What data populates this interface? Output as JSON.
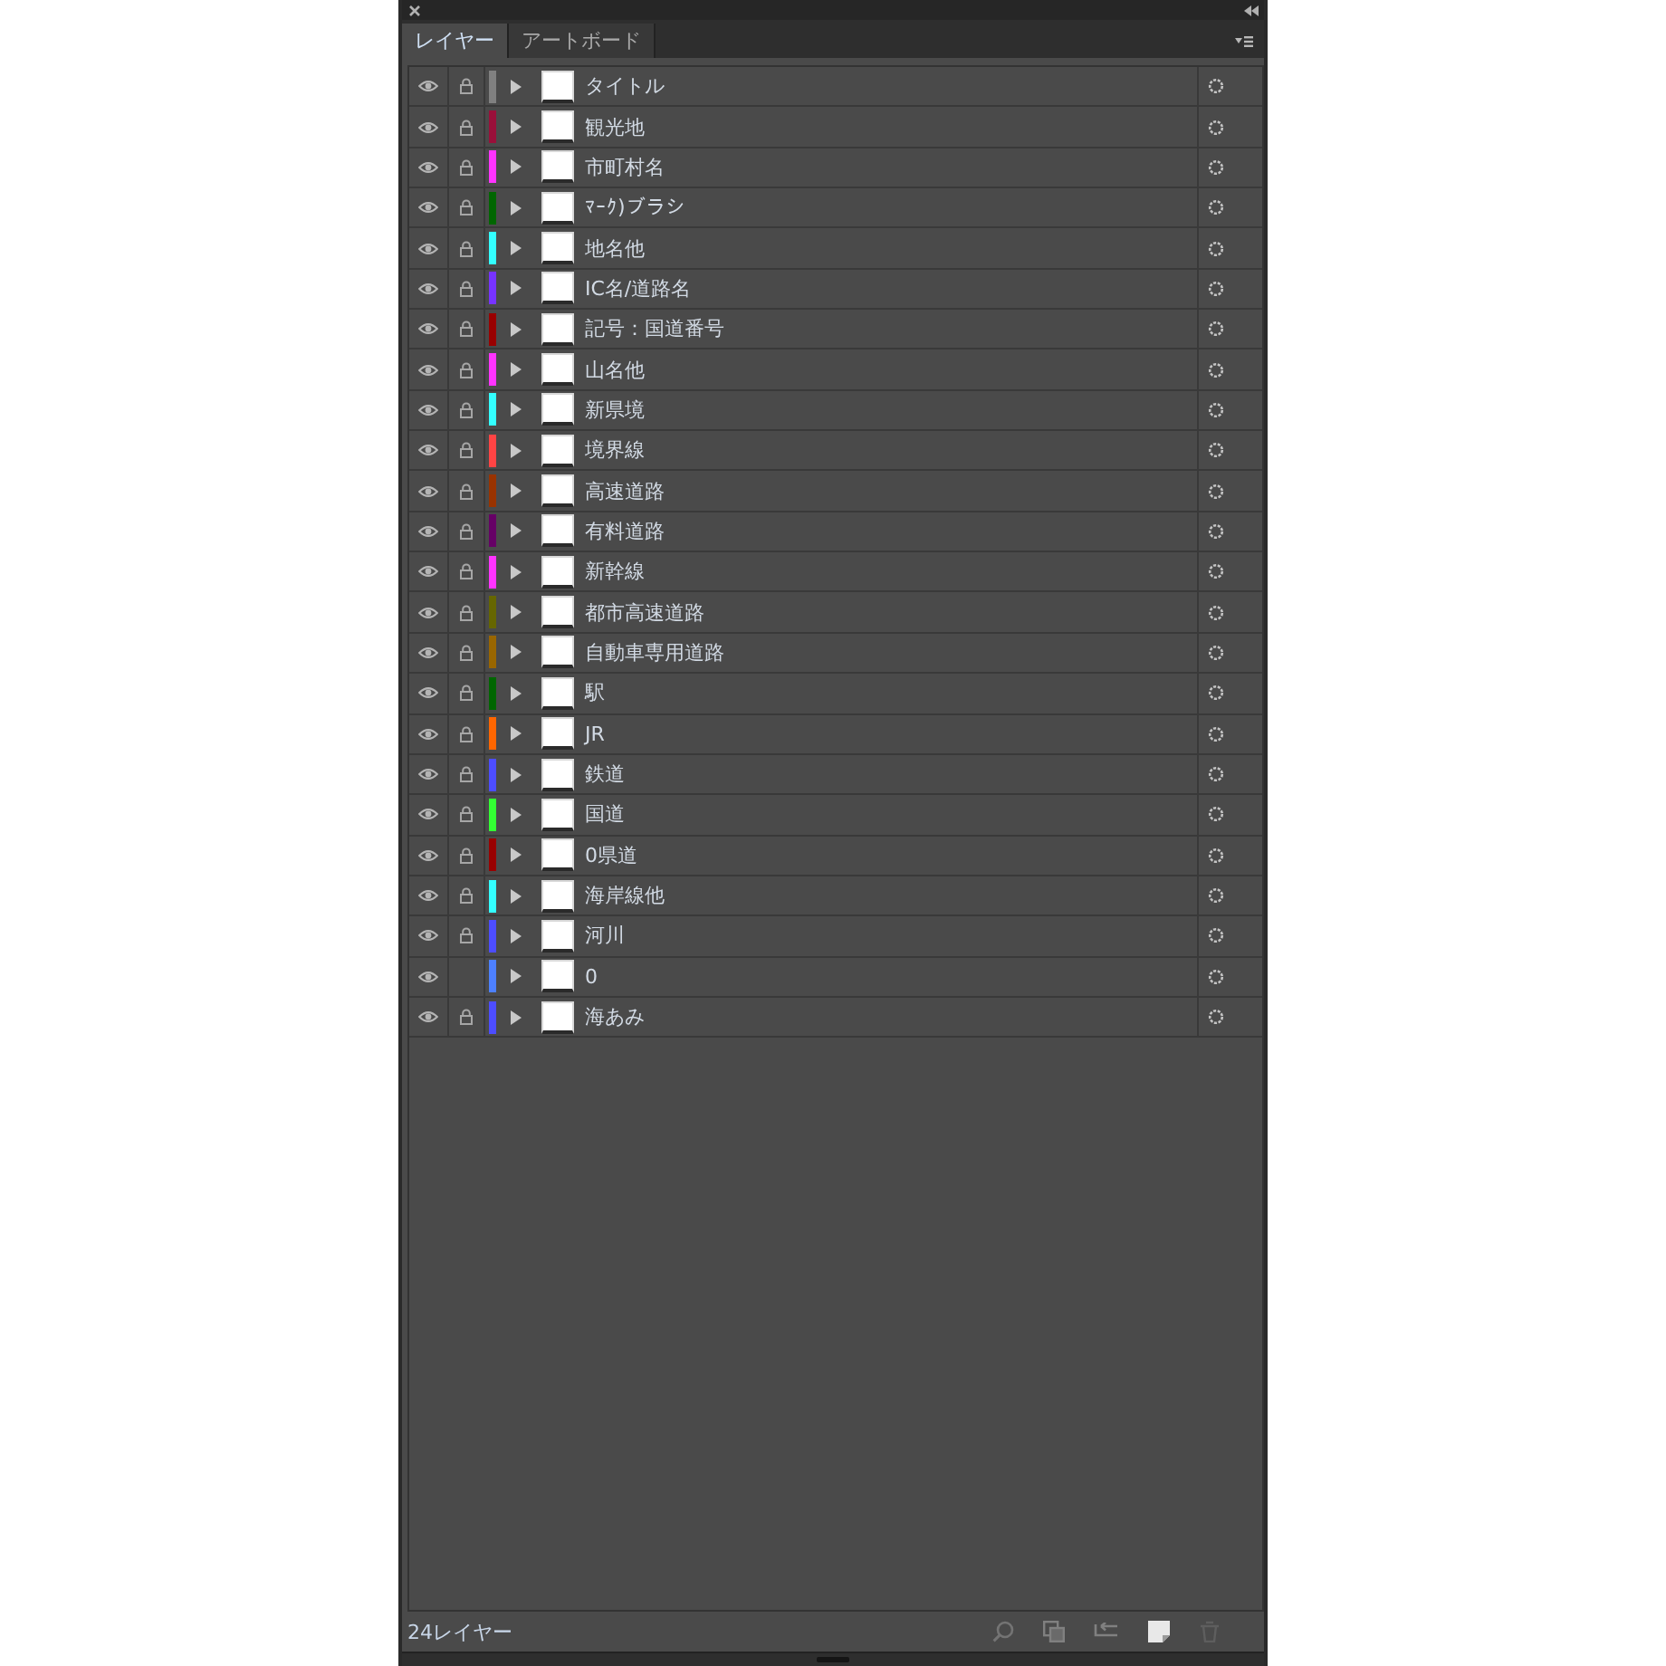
{
  "panel": {
    "tabs": [
      {
        "label": "レイヤー",
        "selected": true
      },
      {
        "label": "アートボード",
        "selected": false
      }
    ]
  },
  "layers": [
    {
      "name": "タイトル",
      "visible": true,
      "locked": true,
      "expanded": false,
      "selected": false,
      "color": "#808080"
    },
    {
      "name": "観光地",
      "visible": true,
      "locked": true,
      "expanded": false,
      "selected": false,
      "color": "#99103a"
    },
    {
      "name": "市町村名",
      "visible": true,
      "locked": true,
      "expanded": false,
      "selected": false,
      "color": "#ff33ff"
    },
    {
      "name": "ﾏｰｸ)ブラシ",
      "visible": true,
      "locked": true,
      "expanded": false,
      "selected": false,
      "color": "#006600"
    },
    {
      "name": "地名他",
      "visible": true,
      "locked": true,
      "expanded": false,
      "selected": false,
      "color": "#33ffff"
    },
    {
      "name": "IC名/道路名",
      "visible": true,
      "locked": true,
      "expanded": false,
      "selected": false,
      "color": "#7733ff"
    },
    {
      "name": "記号：国道番号",
      "visible": true,
      "locked": true,
      "expanded": false,
      "selected": false,
      "color": "#990000"
    },
    {
      "name": "山名他",
      "visible": true,
      "locked": true,
      "expanded": false,
      "selected": false,
      "color": "#ff33ff"
    },
    {
      "name": "新県境",
      "visible": true,
      "locked": true,
      "expanded": false,
      "selected": false,
      "color": "#33ffff"
    },
    {
      "name": "境界線",
      "visible": true,
      "locked": true,
      "expanded": false,
      "selected": false,
      "color": "#ff4444"
    },
    {
      "name": "高速道路",
      "visible": true,
      "locked": true,
      "expanded": false,
      "selected": false,
      "color": "#993300"
    },
    {
      "name": "有料道路",
      "visible": true,
      "locked": true,
      "expanded": false,
      "selected": false,
      "color": "#660066"
    },
    {
      "name": "新幹線",
      "visible": true,
      "locked": true,
      "expanded": false,
      "selected": false,
      "color": "#ff33ff"
    },
    {
      "name": "都市高速道路",
      "visible": true,
      "locked": true,
      "expanded": false,
      "selected": false,
      "color": "#666600"
    },
    {
      "name": "自動車専用道路",
      "visible": true,
      "locked": true,
      "expanded": false,
      "selected": false,
      "color": "#996600"
    },
    {
      "name": "駅",
      "visible": true,
      "locked": true,
      "expanded": false,
      "selected": false,
      "color": "#006600"
    },
    {
      "name": "JR",
      "visible": true,
      "locked": true,
      "expanded": false,
      "selected": false,
      "color": "#ff6600"
    },
    {
      "name": "鉄道",
      "visible": true,
      "locked": true,
      "expanded": false,
      "selected": false,
      "color": "#4d4dff"
    },
    {
      "name": "国道",
      "visible": true,
      "locked": true,
      "expanded": false,
      "selected": false,
      "color": "#33ff33"
    },
    {
      "name": "0県道",
      "visible": true,
      "locked": true,
      "expanded": false,
      "selected": false,
      "color": "#990000"
    },
    {
      "name": "海岸線他",
      "visible": true,
      "locked": true,
      "expanded": false,
      "selected": false,
      "color": "#33ffff"
    },
    {
      "name": "河川",
      "visible": true,
      "locked": true,
      "expanded": false,
      "selected": false,
      "color": "#4d4dff"
    },
    {
      "name": "0",
      "visible": true,
      "locked": false,
      "expanded": false,
      "selected": false,
      "color": "#4d80ff"
    },
    {
      "name": "海あみ",
      "visible": true,
      "locked": true,
      "expanded": false,
      "selected": false,
      "color": "#4d4dff"
    }
  ],
  "footer": {
    "count": "24レイヤー"
  }
}
